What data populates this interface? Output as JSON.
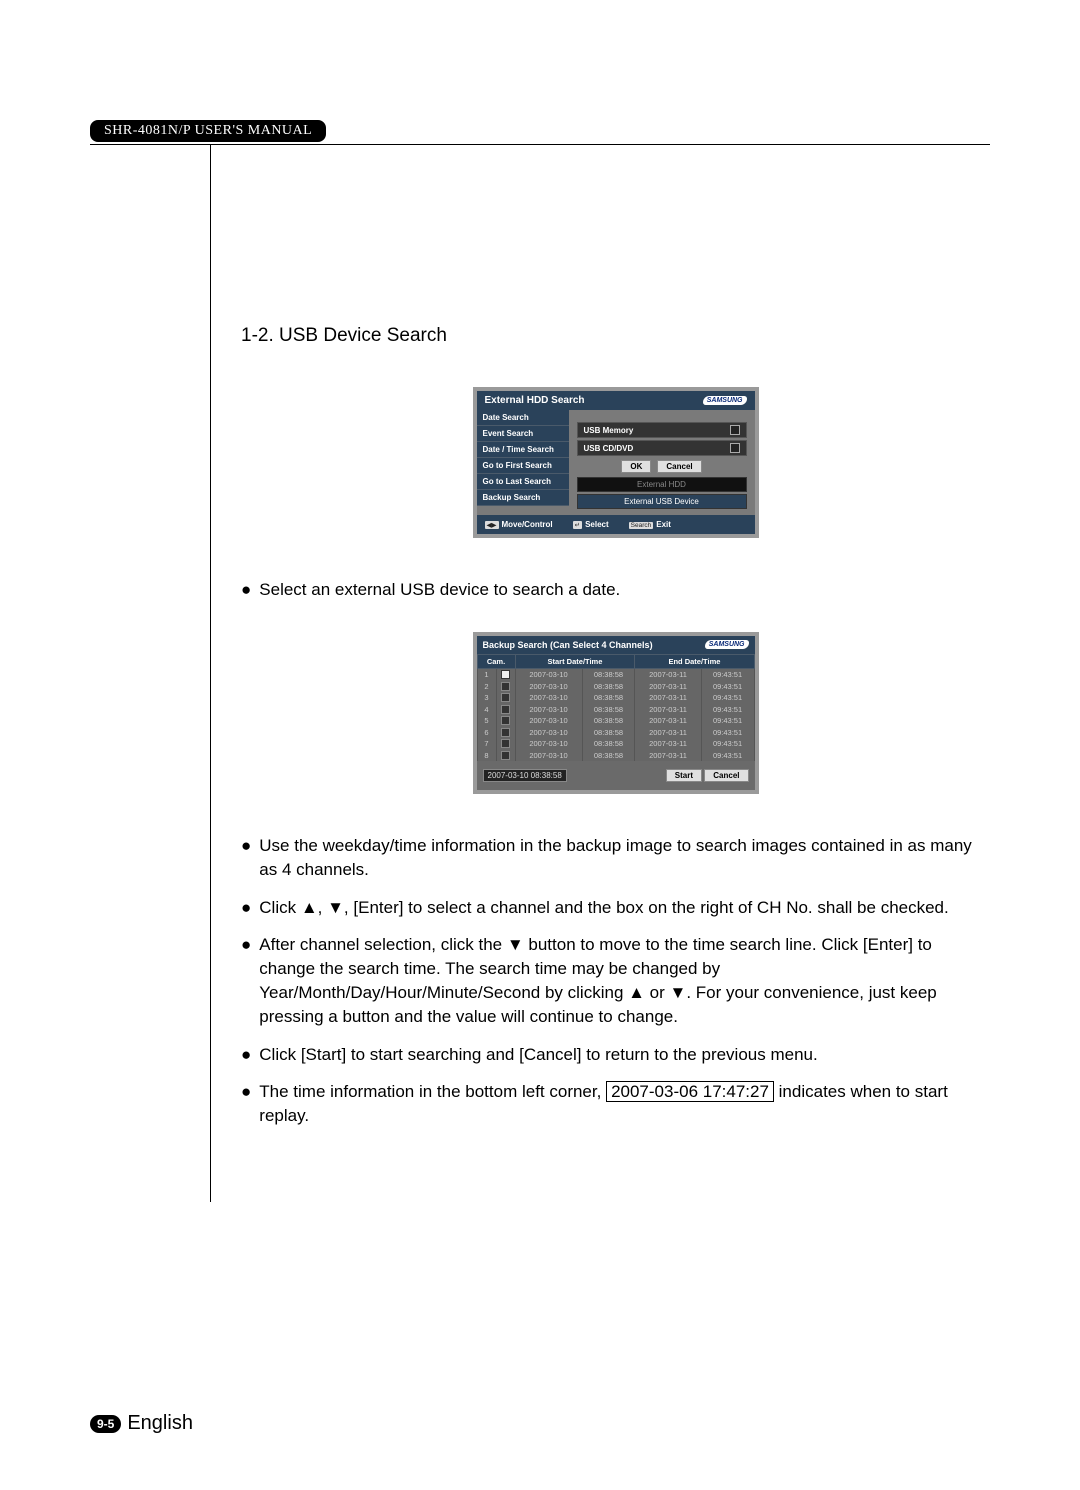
{
  "header_badge": "SHR-4081N/P USER'S MANUAL",
  "section_title": "1-2. USB Device Search",
  "brand": "SAMSUNG",
  "shot1": {
    "title": "External HDD Search",
    "menu": [
      "Date Search",
      "Event Search",
      "Date / Time Search",
      "Go to First Search",
      "Go to Last Search",
      "Backup Search"
    ],
    "opt1": "USB Memory",
    "opt2": "USB CD/DVD",
    "ok": "OK",
    "cancel": "Cancel",
    "opt3": "External HDD",
    "opt4": "External USB Device",
    "footer": {
      "move": "Move/Control",
      "select": "Select",
      "search": "Search",
      "exit": "Exit"
    }
  },
  "bullet1": "Select an external USB device to search a date.",
  "shot2": {
    "title": "Backup Search (Can Select 4 Channels)",
    "cols": {
      "cam": "Cam.",
      "start": "Start Date/Time",
      "end": "End Date/Time"
    },
    "rows": [
      {
        "n": "1",
        "ck": true,
        "sd": "2007-03-10",
        "st": "08:38:58",
        "ed": "2007-03-11",
        "et": "09:43:51"
      },
      {
        "n": "2",
        "ck": false,
        "sd": "2007-03-10",
        "st": "08:38:58",
        "ed": "2007-03-11",
        "et": "09:43:51"
      },
      {
        "n": "3",
        "ck": false,
        "sd": "2007-03-10",
        "st": "08:38:58",
        "ed": "2007-03-11",
        "et": "09:43:51"
      },
      {
        "n": "4",
        "ck": false,
        "sd": "2007-03-10",
        "st": "08:38:58",
        "ed": "2007-03-11",
        "et": "09:43:51"
      },
      {
        "n": "5",
        "ck": false,
        "sd": "2007-03-10",
        "st": "08:38:58",
        "ed": "2007-03-11",
        "et": "09:43:51"
      },
      {
        "n": "6",
        "ck": false,
        "sd": "2007-03-10",
        "st": "08:38:58",
        "ed": "2007-03-11",
        "et": "09:43:51"
      },
      {
        "n": "7",
        "ck": false,
        "sd": "2007-03-10",
        "st": "08:38:58",
        "ed": "2007-03-11",
        "et": "09:43:51"
      },
      {
        "n": "8",
        "ck": false,
        "sd": "2007-03-10",
        "st": "08:38:58",
        "ed": "2007-03-11",
        "et": "09:43:51"
      }
    ],
    "datetime": "2007-03-10   08:38:58",
    "start": "Start",
    "cancel": "Cancel"
  },
  "bullets": {
    "b2": "Use the weekday/time information in the backup image to search images contained in as many as 4 channels.",
    "b3": "Click ▲, ▼, [Enter] to select a channel and the box on the right of CH No. shall be checked.",
    "b4": "After channel selection, click the ▼ button to move to the time search line. Click [Enter] to change the search time. The search time may be changed by Year/Month/Day/Hour/Minute/Second by clicking ▲ or ▼. For your convenience, just keep pressing a button and the value will continue to change.",
    "b5": "Click [Start] to start searching and [Cancel] to return to the previous menu.",
    "b6a": "The time information in the bottom left corner, ",
    "b6box": "2007-03-06 17:47:27",
    "b6b": " indicates when to start replay."
  },
  "page_num": "9-5",
  "language": "English"
}
